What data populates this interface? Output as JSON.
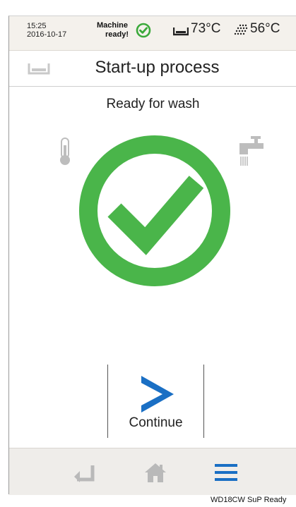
{
  "status_bar": {
    "time": "15:25",
    "date": "2016-10-17",
    "machine_line1": "Machine",
    "machine_line2": "ready!",
    "bath_temp": "73°C",
    "spray_temp": "56°C"
  },
  "title_bar": {
    "title": "Start-up process",
    "icon": "bath-icon"
  },
  "main": {
    "status_text": "Ready for wash",
    "status_icon": "check-circle-icon",
    "left_icon": "thermometer-icon",
    "right_icon": "tap-icon"
  },
  "continue_button": {
    "label": "Continue",
    "icon": "chevron-right-icon"
  },
  "bottom_nav": {
    "items": [
      "back-icon",
      "home-icon",
      "menu-icon"
    ]
  },
  "footer": {
    "code": "WD18CW  SuP  Ready"
  },
  "colors": {
    "success_green": "#4ab54a",
    "accent_blue": "#1a6fc4",
    "icon_gray": "#c2c2c2",
    "statusbar_bg": "#f4f1ec",
    "bottombar_bg": "#efedea"
  }
}
